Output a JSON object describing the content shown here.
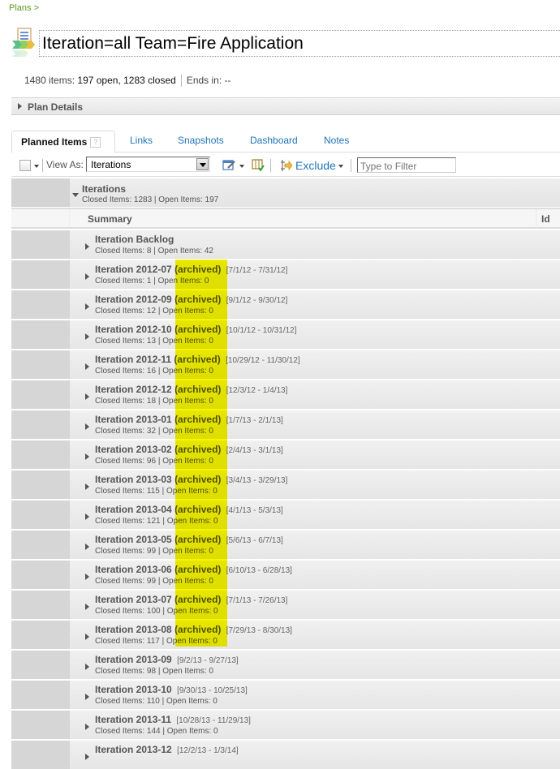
{
  "breadcrumb": "Plans >",
  "title": "Iteration=all Team=Fire Application",
  "summary": {
    "count": "1480 items:",
    "open_closed": "197 open, 1283 closed",
    "ends": "Ends in:",
    "ends_value": "--"
  },
  "plan_details": "Plan Details",
  "tabs": [
    {
      "label": "Planned Items",
      "help": "?"
    },
    {
      "label": "Links"
    },
    {
      "label": "Snapshots"
    },
    {
      "label": "Dashboard"
    },
    {
      "label": "Notes"
    }
  ],
  "toolbar": {
    "view_as_label": "View As:",
    "view_as_value": "Iterations",
    "exclude_label": "Exclude",
    "filter_placeholder": "Type to Filter"
  },
  "group": {
    "title": "Iterations",
    "sub": "Closed Items: 1283 | Open Items: 197"
  },
  "columns": {
    "summary": "Summary",
    "id": "Id"
  },
  "highlight_color": "#f5f500",
  "rows": [
    {
      "name": "Iteration Backlog",
      "arch": "",
      "dates": "",
      "sub": "Closed Items: 8 | Open Items: 42"
    },
    {
      "name": "Iteration 2012-07",
      "arch": "(archived)",
      "dates": "[7/1/12 - 7/31/12]",
      "sub": "Closed Items: 1 | Open Items: 0"
    },
    {
      "name": "Iteration 2012-09",
      "arch": "(archived)",
      "dates": "[9/1/12 - 9/30/12]",
      "sub": "Closed Items: 12 | Open Items: 0"
    },
    {
      "name": "Iteration 2012-10",
      "arch": "(archived)",
      "dates": "[10/1/12 - 10/31/12]",
      "sub": "Closed Items: 13 | Open Items: 0"
    },
    {
      "name": "Iteration 2012-11",
      "arch": "(archived)",
      "dates": "[10/29/12 - 11/30/12]",
      "sub": "Closed Items: 16 | Open Items: 0"
    },
    {
      "name": "Iteration 2012-12",
      "arch": "(archived)",
      "dates": "[12/3/12 - 1/4/13]",
      "sub": "Closed Items: 18 | Open Items: 0"
    },
    {
      "name": "Iteration 2013-01",
      "arch": "(archived)",
      "dates": "[1/7/13 - 2/1/13]",
      "sub": "Closed Items: 32 | Open Items: 0"
    },
    {
      "name": "Iteration 2013-02",
      "arch": "(archived)",
      "dates": "[2/4/13 - 3/1/13]",
      "sub": "Closed Items: 96 | Open Items: 0"
    },
    {
      "name": "Iteration 2013-03",
      "arch": "(archived)",
      "dates": "[3/4/13 - 3/29/13]",
      "sub": "Closed Items: 115 | Open Items: 0"
    },
    {
      "name": "Iteration 2013-04",
      "arch": "(archived)",
      "dates": "[4/1/13 - 5/3/13]",
      "sub": "Closed Items: 121 | Open Items: 0"
    },
    {
      "name": "Iteration 2013-05",
      "arch": "(archived)",
      "dates": "[5/6/13 - 6/7/13]",
      "sub": "Closed Items: 99 | Open Items: 0"
    },
    {
      "name": "Iteration 2013-06",
      "arch": "(archived)",
      "dates": "[6/10/13 - 6/28/13]",
      "sub": "Closed Items: 99 | Open Items: 0"
    },
    {
      "name": "Iteration 2013-07",
      "arch": "(archived)",
      "dates": "[7/1/13 - 7/26/13]",
      "sub": "Closed Items: 100 | Open Items: 0"
    },
    {
      "name": "Iteration 2013-08",
      "arch": "(archived)",
      "dates": "[7/29/13 - 8/30/13]",
      "sub": "Closed Items: 117 | Open Items: 0"
    },
    {
      "name": "Iteration 2013-09",
      "arch": "",
      "dates": "[9/2/13 - 9/27/13]",
      "sub": "Closed Items: 98 | Open Items: 0"
    },
    {
      "name": "Iteration 2013-10",
      "arch": "",
      "dates": "[9/30/13 - 10/25/13]",
      "sub": "Closed Items: 110 | Open Items: 0"
    },
    {
      "name": "Iteration 2013-11",
      "arch": "",
      "dates": "[10/28/13 - 11/29/13]",
      "sub": "Closed Items: 144 | Open Items: 0"
    },
    {
      "name": "Iteration 2013-12",
      "arch": "",
      "dates": "[12/2/13 - 1/3/14]",
      "sub": ""
    }
  ]
}
